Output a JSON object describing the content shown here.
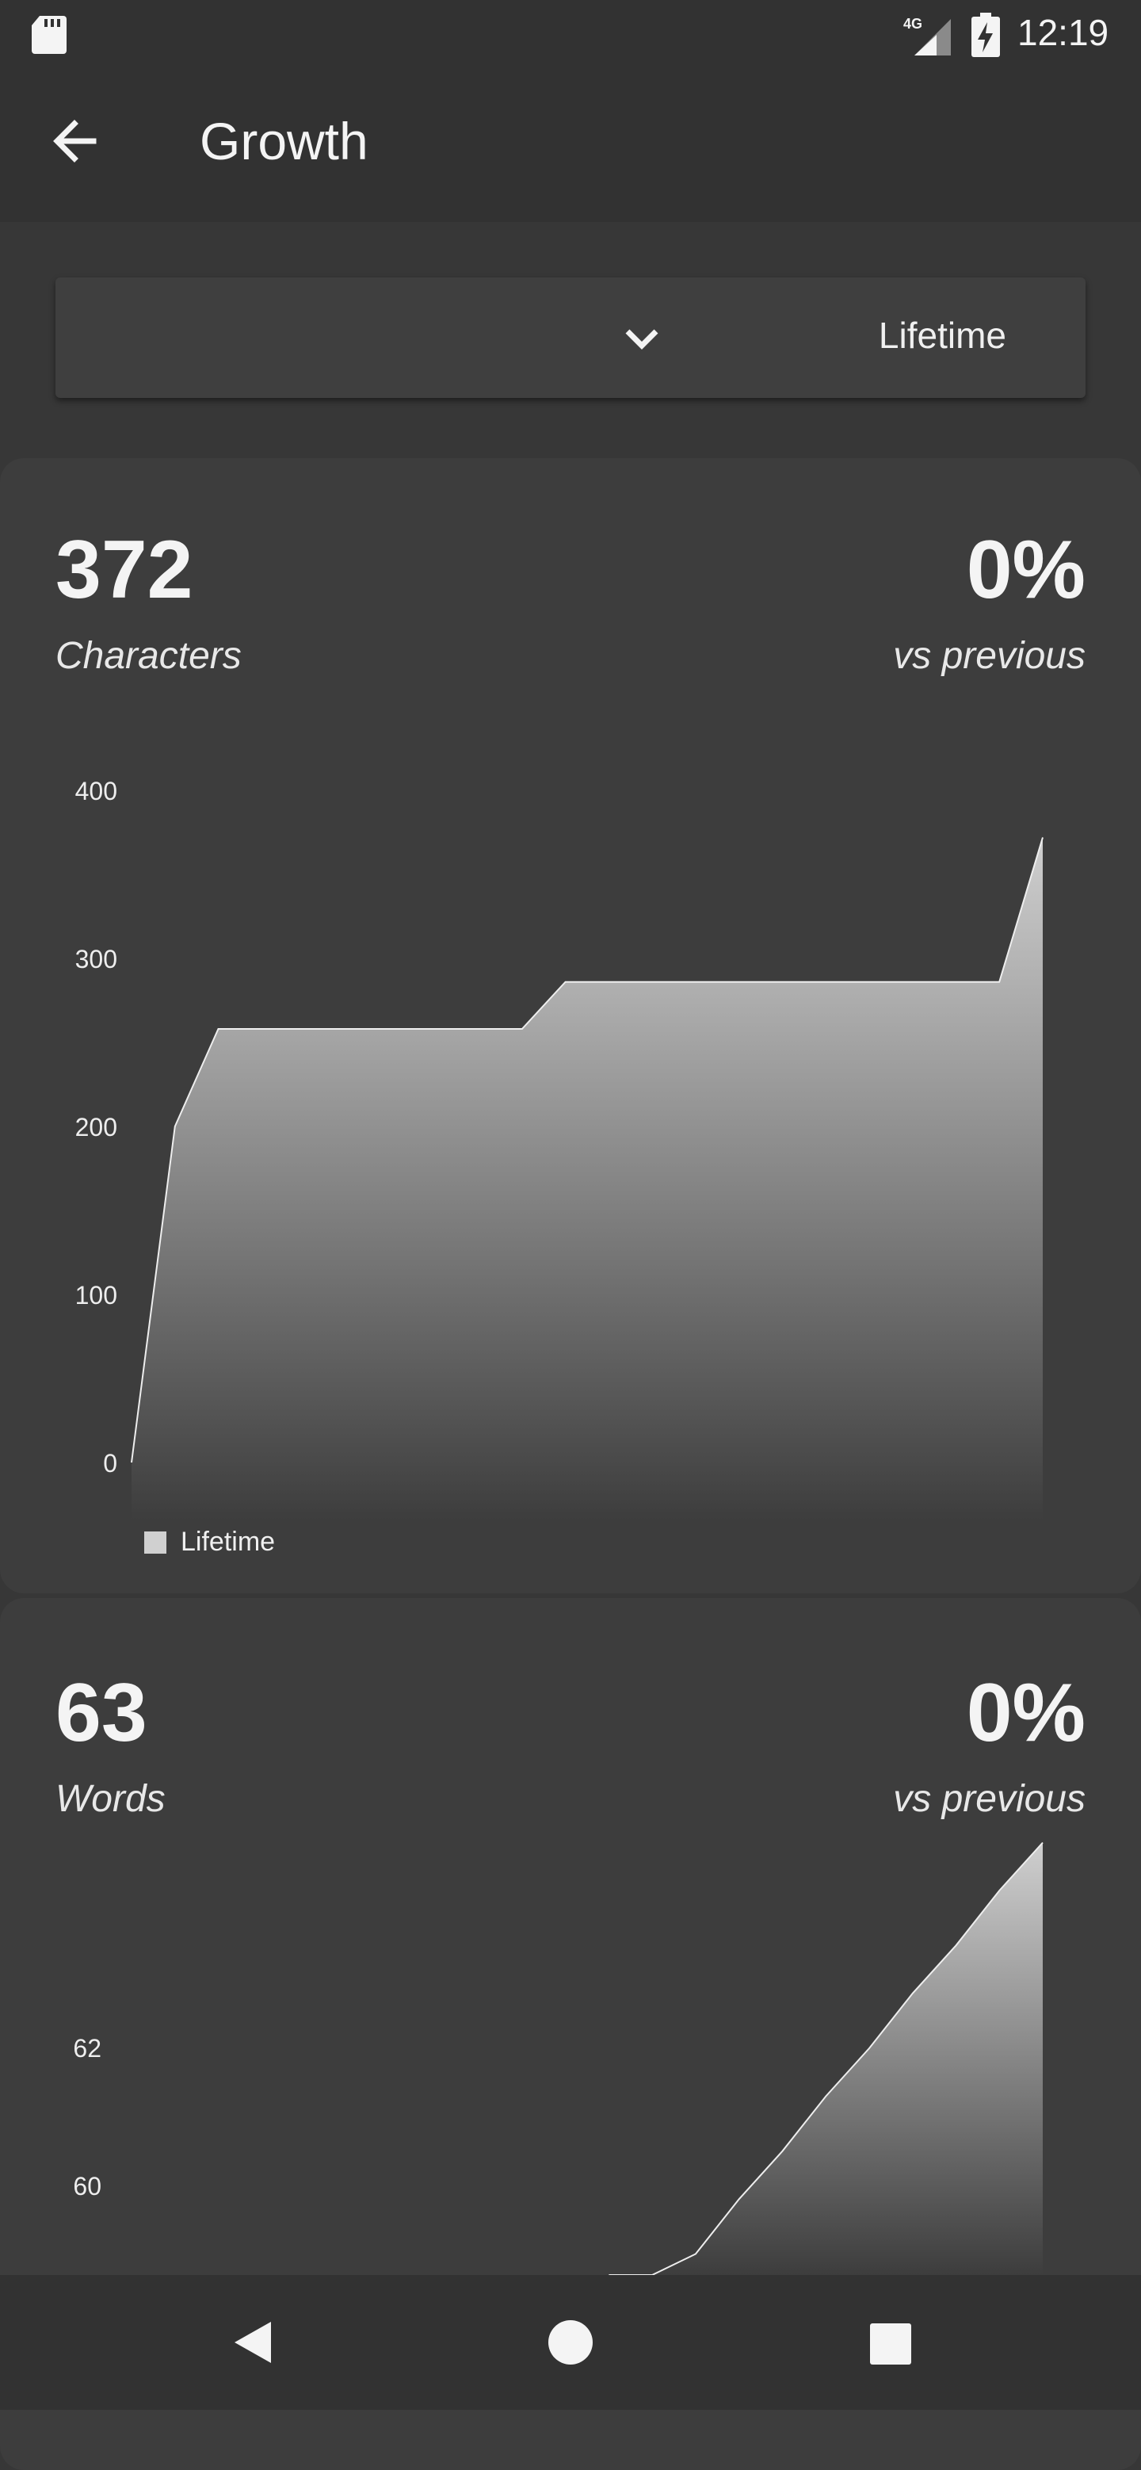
{
  "status_bar": {
    "time": "12:19",
    "network": "4G"
  },
  "app_bar": {
    "title": "Growth"
  },
  "period_selector": {
    "selected": "Lifetime"
  },
  "characters_card": {
    "value": "372",
    "label": "Characters",
    "change": "0%",
    "change_label": "vs previous"
  },
  "words_card": {
    "value": "63",
    "label": "Words",
    "change": "0%",
    "change_label": "vs previous"
  },
  "colors": {
    "background": "#373737",
    "card": "#3d3d3d",
    "bars": "#323232",
    "area_top": "#cfcfcf",
    "area_bottom": "#3d3d3d"
  },
  "chart_data": [
    {
      "type": "area",
      "y_ticks": [
        "0",
        "100",
        "200",
        "300",
        "400"
      ],
      "ylim": [
        0,
        400
      ],
      "x": [
        0,
        1,
        2,
        3,
        4,
        5,
        6,
        7,
        8,
        9,
        10,
        11,
        12,
        13,
        14,
        15,
        16,
        17,
        18,
        19,
        20,
        21
      ],
      "series": [
        {
          "name": "Lifetime",
          "values": [
            0,
            200,
            258,
            258,
            258,
            258,
            258,
            258,
            258,
            258,
            286,
            286,
            286,
            286,
            286,
            286,
            286,
            286,
            286,
            286,
            286,
            372
          ]
        }
      ],
      "legend": "bottom-left",
      "grid": false
    },
    {
      "type": "area",
      "y_ticks": [
        "60",
        "62"
      ],
      "x": [
        0,
        1,
        2,
        3,
        4,
        5,
        6,
        7,
        8,
        9,
        10,
        11,
        12,
        13,
        14,
        15,
        16,
        17,
        18,
        19,
        20,
        21
      ],
      "series": [
        {
          "name": "Lifetime",
          "values": [
            null,
            null,
            null,
            null,
            null,
            null,
            null,
            null,
            null,
            null,
            null,
            57.5,
            58.3,
            59.0,
            59.8,
            60.5,
            61.3,
            62.0,
            62.8,
            63.5,
            64.3,
            65.0
          ]
        }
      ],
      "legend": "bottom-left",
      "grid": false
    }
  ]
}
